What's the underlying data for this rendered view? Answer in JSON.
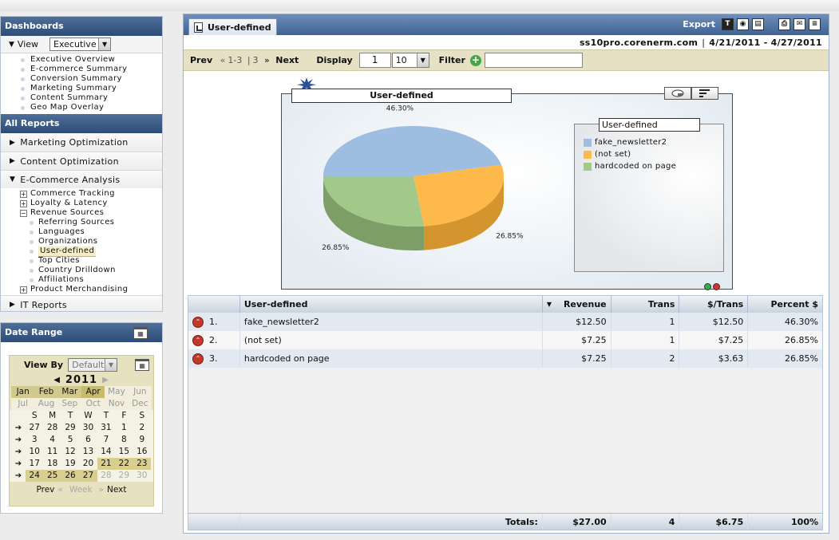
{
  "sidebar": {
    "dashboards_title": "Dashboards",
    "view_label": "View",
    "view_value": "Executive",
    "dashboards": [
      "Executive Overview",
      "E-commerce Summary",
      "Conversion Summary",
      "Marketing Summary",
      "Content Summary",
      "Geo Map Overlay"
    ],
    "all_reports_title": "All Reports",
    "cat_marketing": "Marketing Optimization",
    "cat_content": "Content Optimization",
    "cat_ecommerce": "E-Commerce Analysis",
    "commerce_tracking": "Commerce Tracking",
    "loyalty": "Loyalty & Latency",
    "revenue_sources": "Revenue Sources",
    "revenue_children": [
      "Referring Sources",
      "Languages",
      "Organizations",
      "User-defined",
      "Top Cities",
      "Country Drilldown",
      "Affiliations"
    ],
    "product_merch": "Product Merchandising",
    "cat_it": "IT Reports"
  },
  "daterange": {
    "title": "Date Range",
    "viewby_label": "View By",
    "viewby_value": "Default",
    "year": "2011",
    "months": [
      "Jan",
      "Feb",
      "Mar",
      "Apr",
      "May",
      "Jun",
      "Jul",
      "Aug",
      "Sep",
      "Oct",
      "Nov",
      "Dec"
    ],
    "weekdays": [
      "S",
      "M",
      "T",
      "W",
      "T",
      "F",
      "S"
    ],
    "weeks": [
      [
        "27",
        "28",
        "29",
        "30",
        "31",
        "1",
        "2"
      ],
      [
        "3",
        "4",
        "5",
        "6",
        "7",
        "8",
        "9"
      ],
      [
        "10",
        "11",
        "12",
        "13",
        "14",
        "15",
        "16"
      ],
      [
        "17",
        "18",
        "19",
        "20",
        "21",
        "22",
        "23"
      ],
      [
        "24",
        "25",
        "26",
        "27",
        "28",
        "29",
        "30"
      ]
    ],
    "prev": "Prev",
    "week": "Week",
    "next": "Next"
  },
  "main": {
    "tab_title": "User-defined",
    "export_label": "Export",
    "site": "ss10pro.corenerm.com",
    "date_range": "4/21/2011 - 4/27/2011",
    "prev": "Prev",
    "page_current": "1-3",
    "page_total": "3",
    "next": "Next",
    "display_label": "Display",
    "display_value": "1",
    "per_page": "10",
    "filter_label": "Filter",
    "filter_value": ""
  },
  "chart_data": {
    "type": "pie",
    "title": "User-defined",
    "legend_title": "User-defined",
    "categories": [
      "fake_newsletter2",
      "(not set)",
      "hardcoded on page"
    ],
    "values": [
      46.3,
      26.85,
      26.85
    ],
    "labels": [
      "46.30%",
      "26.85%",
      "26.85%"
    ],
    "colors": [
      "#9dbde1",
      "#fdb94a",
      "#a2c98a"
    ],
    "side_colors": [
      "#6f8fb5",
      "#d4952e",
      "#7d9f67"
    ]
  },
  "table": {
    "headers": [
      "User-defined",
      "Revenue",
      "Trans",
      "$/Trans",
      "Percent $"
    ],
    "rows": [
      {
        "rank": "1.",
        "name": "fake_newsletter2",
        "revenue": "$12.50",
        "trans": "1",
        "per": "$12.50",
        "pct": "46.30%"
      },
      {
        "rank": "2.",
        "name": "(not set)",
        "revenue": "$7.25",
        "trans": "1",
        "per": "$7.25",
        "pct": "26.85%"
      },
      {
        "rank": "3.",
        "name": "hardcoded on page",
        "revenue": "$7.25",
        "trans": "2",
        "per": "$3.63",
        "pct": "26.85%"
      }
    ],
    "totals_label": "Totals:",
    "totals": {
      "revenue": "$27.00",
      "trans": "4",
      "per": "$6.75",
      "pct": "100%"
    }
  }
}
